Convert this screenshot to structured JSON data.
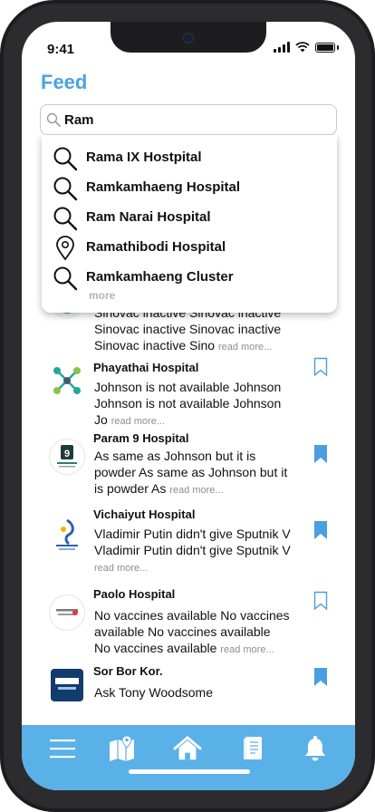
{
  "status": {
    "time": "9:41"
  },
  "header": {
    "title": "Feed"
  },
  "search": {
    "value": "Ram"
  },
  "suggestions": [
    {
      "label": "Rama IX Hostpital",
      "icon": "search-icon"
    },
    {
      "label": "Ramkamhaeng Hospital",
      "icon": "search-icon"
    },
    {
      "label": "Ram Narai Hospital",
      "icon": "search-icon"
    },
    {
      "label": "Ramathibodi Hospital",
      "icon": "location-pin-icon"
    },
    {
      "label": "Ramkamhaeng Cluster",
      "icon": "search-icon"
    }
  ],
  "suggestions_more": "more",
  "posts": [
    {
      "name": "",
      "line1": "Sinovac inactive Sinovac inactive",
      "line2": "Sinovac inactive Sinovac inactive",
      "line3": "Sinovac inactive Sino",
      "read_more": "read more...",
      "bookmarked": false
    },
    {
      "name": "Phayathai Hospital",
      "line1": "Johnson is not available Johnson",
      "line2": "Johnson is not available Johnson",
      "line3": "Jo",
      "read_more": "read more...",
      "bookmarked": false
    },
    {
      "name": "Param 9 Hospital",
      "line1": "As same as Johnson but it is",
      "line2": "powder As same as Johnson but it",
      "line3": "is powder As",
      "read_more": "read more...",
      "bookmarked": true
    },
    {
      "name": "Vichaiyut Hospital",
      "line1": "Vladimir Putin didn't give Sputnik V",
      "line2": "Vladimir Putin didn't give Sputnik V",
      "line3": "",
      "read_more": "read more...",
      "bookmarked": true
    },
    {
      "name": "Paolo Hospital",
      "line1": "No vaccines available No vaccines",
      "line2": "available No vaccines available",
      "line3": "No vaccines available",
      "read_more": "read more...",
      "bookmarked": false
    },
    {
      "name": "Sor Bor Kor.",
      "line1": "Ask Tony Woodsome",
      "line2": "",
      "line3": "",
      "read_more": "",
      "bookmarked": true
    }
  ],
  "colors": {
    "accent": "#4aa3e3",
    "tabbar": "#5ab1e8",
    "bookmark": "#4a9fe0"
  },
  "tabbar_icons": [
    "menu-icon",
    "map-icon",
    "home-icon",
    "book-icon",
    "bell-icon"
  ]
}
